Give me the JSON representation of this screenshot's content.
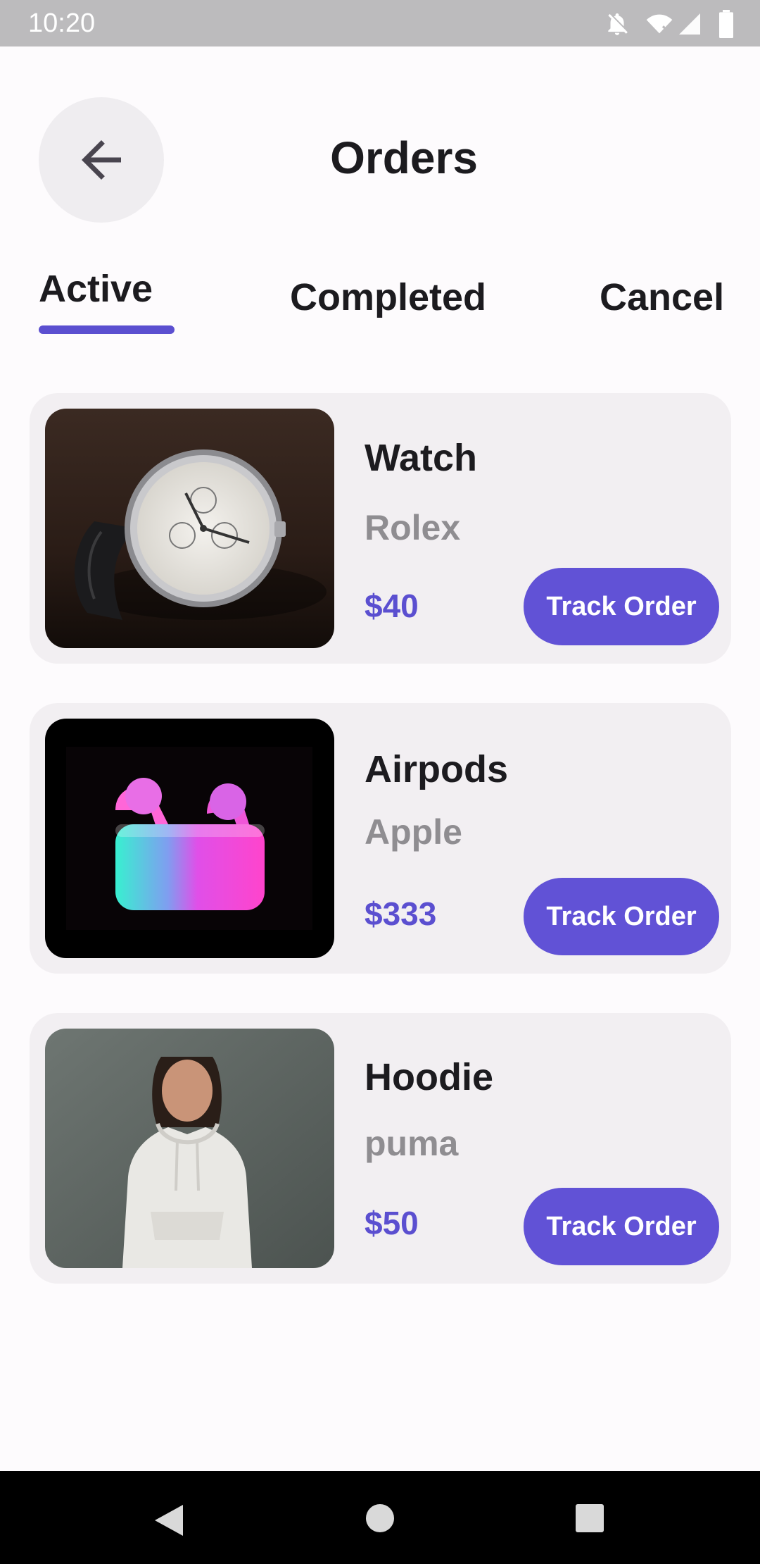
{
  "status_bar": {
    "time": "10:20",
    "icons": [
      "notifications-off-icon",
      "wifi-icon",
      "signal-icon",
      "battery-icon"
    ]
  },
  "header": {
    "back_icon": "arrow-back-icon",
    "title": "Orders"
  },
  "tabs": [
    {
      "label": "Active",
      "selected": true
    },
    {
      "label": "Completed",
      "selected": false
    },
    {
      "label": "Cancel",
      "selected": false
    }
  ],
  "orders": [
    {
      "name": "Watch",
      "brand": "Rolex",
      "price": "$40",
      "button": "Track Order",
      "image": "watch-image"
    },
    {
      "name": "Airpods",
      "brand": "Apple",
      "price": "$333",
      "button": "Track Order",
      "image": "airpods-image"
    },
    {
      "name": "Hoodie",
      "brand": "puma",
      "price": "$50",
      "button": "Track Order",
      "image": "hoodie-image"
    }
  ],
  "colors": {
    "accent": "#5b4fd0",
    "button": "#6152d6",
    "card": "#f2eff2",
    "muted_text": "#8f8d91"
  },
  "nav_bar": {
    "icons": [
      "back-triangle-icon",
      "home-circle-icon",
      "recents-square-icon"
    ]
  }
}
